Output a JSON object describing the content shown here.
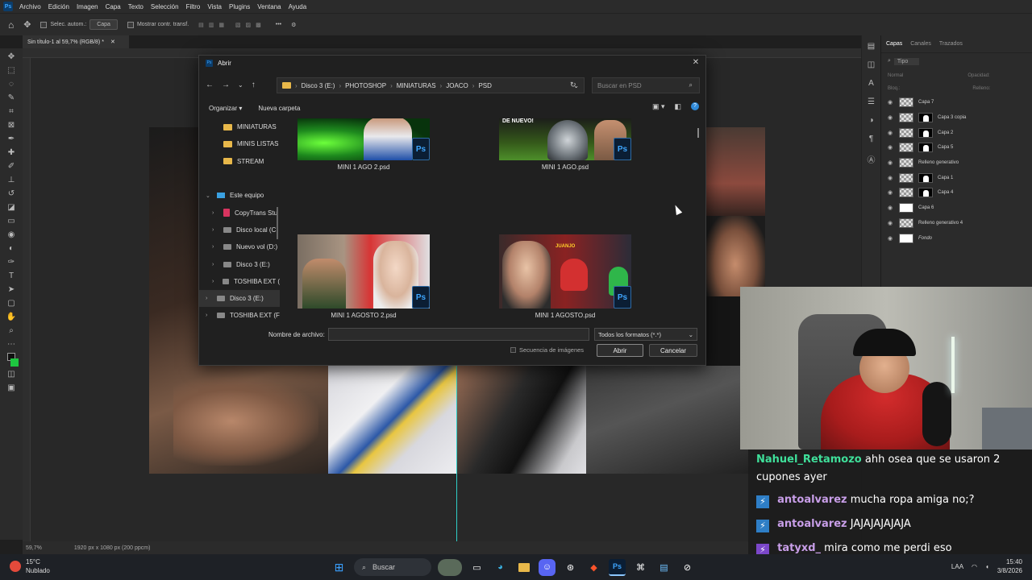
{
  "menubar": {
    "items": [
      "Archivo",
      "Edición",
      "Imagen",
      "Capa",
      "Texto",
      "Selección",
      "Filtro",
      "Vista",
      "Plugins",
      "Ventana",
      "Ayuda"
    ]
  },
  "optionsbar": {
    "auto_select_label": "Selec. autom.:",
    "auto_select_value": "Capa",
    "show_transform_label": "Mostrar contr. transf."
  },
  "document": {
    "tab_title": "Sin título-1 al 59,7% (RGB/8) *",
    "zoom": "59,7%",
    "size_info": "1920 px x 1080 px (200 ppcm)"
  },
  "layers_panel": {
    "tabs": [
      "Capas",
      "Canales",
      "Trazados"
    ],
    "filter_label": "Tipo",
    "blend_mode": "Normal",
    "opacity_label": "Opacidad:",
    "lock_label": "Bloq.:",
    "fill_label": "Relleno:",
    "layers": [
      {
        "name": "Capa 7",
        "mask": false
      },
      {
        "name": "Capa 3 copia",
        "mask": true
      },
      {
        "name": "Capa 2",
        "mask": true
      },
      {
        "name": "Capa 5",
        "mask": true
      },
      {
        "name": "Relleno generativo",
        "mask": false
      },
      {
        "name": "Capa 1",
        "mask": true
      },
      {
        "name": "Capa 4",
        "mask": true
      },
      {
        "name": "Capa 6",
        "mask": false
      },
      {
        "name": "Relleno generativo 4",
        "mask": false
      },
      {
        "name": "Fondo",
        "mask": false
      }
    ]
  },
  "dialog": {
    "title": "Abrir",
    "breadcrumb": [
      "Disco 3 (E:)",
      "PHOTOSHOP",
      "MINIATURAS",
      "JOACO",
      "PSD"
    ],
    "search_placeholder": "Buscar en PSD",
    "organize_label": "Organizar",
    "new_folder_label": "Nueva carpeta",
    "nav_items": [
      {
        "label": "MINIATURAS",
        "type": "folder",
        "indent": 1
      },
      {
        "label": "MINIS LISTAS",
        "type": "folder",
        "indent": 1
      },
      {
        "label": "STREAM",
        "type": "folder",
        "indent": 1
      },
      {
        "label": "",
        "type": "spacer",
        "indent": 0
      },
      {
        "label": "Este equipo",
        "type": "pc",
        "indent": 0
      },
      {
        "label": "CopyTrans Stu",
        "type": "app",
        "indent": 1
      },
      {
        "label": "Disco local (C:",
        "type": "drive",
        "indent": 1
      },
      {
        "label": "Nuevo vol (D:)",
        "type": "drive",
        "indent": 1
      },
      {
        "label": "Disco 3 (E:)",
        "type": "drive",
        "indent": 1
      },
      {
        "label": "TOSHIBA EXT (",
        "type": "drive",
        "indent": 1
      },
      {
        "label": "Disco 3 (E:)",
        "type": "drive",
        "indent": 0
      },
      {
        "label": "TOSHIBA EXT (F",
        "type": "drive",
        "indent": 0
      }
    ],
    "files": [
      {
        "name": "MINI 1 AGO 2.psd",
        "thumb_text": ""
      },
      {
        "name": "MINI 1 AGO.psd",
        "thumb_text": "DE NUEVO!"
      },
      {
        "name": "MINI 1 AGOSTO 2.psd",
        "thumb_text": ""
      },
      {
        "name": "MINI 1 AGOSTO.psd",
        "thumb_text": "JUANJO"
      }
    ],
    "badge_label": "Ps",
    "filename_label": "Nombre de archivo:",
    "filename_value": "",
    "formats_value": "Todos los formatos (*.*)",
    "sequence_label": "Secuencia de imágenes",
    "open_button": "Abrir",
    "cancel_button": "Cancelar"
  },
  "chat": {
    "messages": [
      {
        "user": "Nahuel_Retamozo",
        "color": "#3fdf9a",
        "text": "ahh osea que se usaron 2 cupones ayer",
        "badge": ""
      },
      {
        "user": "antoalvarez",
        "color": "#c89ee8",
        "text": "mucha ropa amiga no;?",
        "badge": "blue"
      },
      {
        "user": "antoalvarez",
        "color": "#c89ee8",
        "text": "JAJAJAJAJAJA",
        "badge": "blue"
      },
      {
        "user": "tatyxd_",
        "color": "#c89ee8",
        "text": "mira como me perdi eso",
        "badge": "purple"
      }
    ]
  },
  "taskbar": {
    "weather_temp": "15°C",
    "weather_desc": "Nublado",
    "search_label": "Buscar",
    "tray_lang": "LAA",
    "time": "15:40",
    "date": "3/8/2026"
  }
}
